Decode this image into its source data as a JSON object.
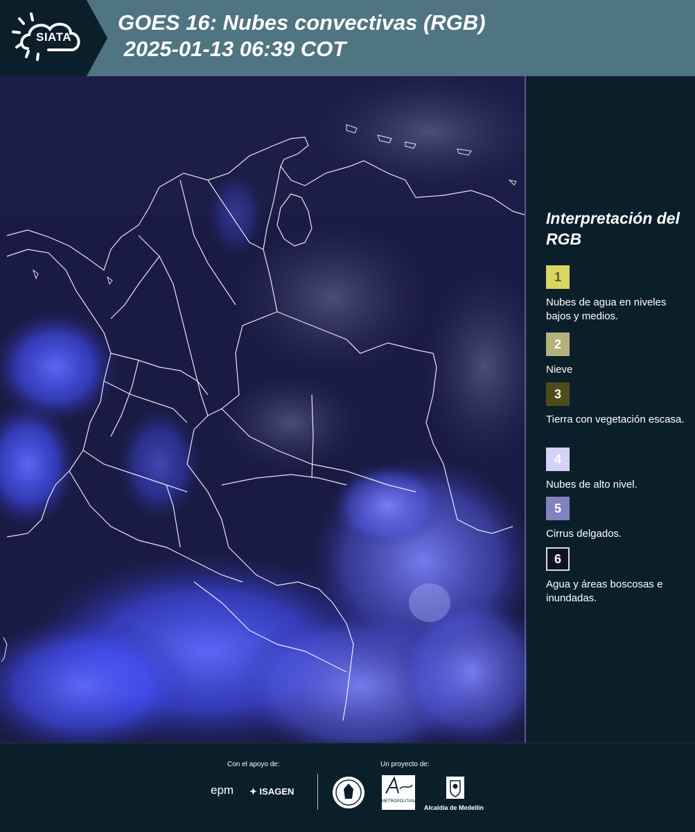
{
  "header": {
    "logo_text": "SIATA",
    "title": "GOES 16: Nubes convectivas (RGB)\n 2025-01-13 06:39 COT",
    "background_color": "#4f7482"
  },
  "map": {
    "product": "Nubes convectivas RGB",
    "colors": {
      "background": "#1a1b45",
      "cloud_blue": "#4a57ff",
      "border_lines": "#ffffff"
    }
  },
  "legend": {
    "title": "Interpretación del RGB",
    "items": [
      {
        "number": "1",
        "label": "Nubes de agua en niveles bajos y medios.",
        "color": "#d8d760",
        "text_color": "#5a5a2a"
      },
      {
        "number": "2",
        "label": "Nieve",
        "color": "#b4b27a",
        "text_color": "#ffffff"
      },
      {
        "number": "3",
        "label": "Tierra con vegetación escasa.",
        "color": "#4d4b1c",
        "text_color": "#ffffff"
      },
      {
        "number": "4",
        "label": "Nubes de alto nivel.",
        "color": "#d4d3f7",
        "text_color": "#ffffff"
      },
      {
        "number": "5",
        "label": "Cirrus delgados.",
        "color": "#8283bd",
        "text_color": "#ffffff"
      },
      {
        "number": "6",
        "label": "Agua y áreas boscosas e inundadas.",
        "color": "#12121f",
        "text_color": "#ffffff"
      }
    ]
  },
  "footer": {
    "support_label": "Con el apoyo de:",
    "project_label": "Un proyecto de:",
    "sponsors": [
      "epm",
      "ISAGEN"
    ],
    "partners": [
      "Área Metropolitana Valle de Aburrá",
      "Alcaldía de Medellín"
    ],
    "metro_name": "METROPOLITANA"
  }
}
